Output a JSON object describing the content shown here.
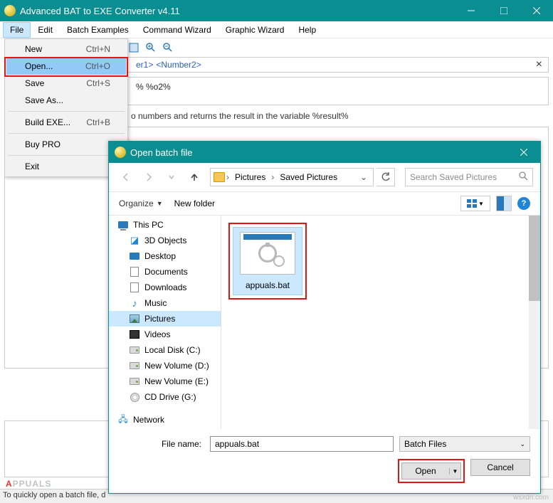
{
  "app": {
    "title": "Advanced BAT to EXE Converter v4.11"
  },
  "menubar": [
    "File",
    "Edit",
    "Batch Examples",
    "Command Wizard",
    "Graphic Wizard",
    "Help"
  ],
  "filemenu": {
    "new": {
      "label": "New",
      "shortcut": "Ctrl+N"
    },
    "open": {
      "label": "Open...",
      "shortcut": "Ctrl+O"
    },
    "save": {
      "label": "Save",
      "shortcut": "Ctrl+S"
    },
    "saveas": {
      "label": "Save As..."
    },
    "build": {
      "label": "Build EXE...",
      "shortcut": "Ctrl+B"
    },
    "buypro": {
      "label": "Buy PRO"
    },
    "exit": {
      "label": "Exit"
    }
  },
  "designer": {
    "placeholder1": "er1>",
    "placeholder2": "<Number2>",
    "code": "% %o2%",
    "description": "o numbers and returns the result in the variable %result%"
  },
  "status": "To quickly open a batch file, d",
  "watermark": {
    "a": "A",
    "rest": "PPUALS"
  },
  "credit": "wsxdn.com",
  "dialog": {
    "title": "Open batch file",
    "breadcrumb": {
      "seg1": "Pictures",
      "seg2": "Saved Pictures"
    },
    "search_placeholder": "Search Saved Pictures",
    "organize": "Organize",
    "newfolder": "New folder",
    "tree": {
      "thispc": "This PC",
      "objects3d": "3D Objects",
      "desktop": "Desktop",
      "documents": "Documents",
      "downloads": "Downloads",
      "music": "Music",
      "pictures": "Pictures",
      "videos": "Videos",
      "localc": "Local Disk (C:)",
      "newvold": "New Volume (D:)",
      "newvole": "New Volume (E:)",
      "cddrive": "CD Drive (G:)",
      "network": "Network"
    },
    "file": {
      "name": "appuals.bat"
    },
    "filename_label": "File name:",
    "filename_value": "appuals.bat",
    "filter": "Batch Files",
    "open_btn": "Open",
    "cancel_btn": "Cancel"
  }
}
